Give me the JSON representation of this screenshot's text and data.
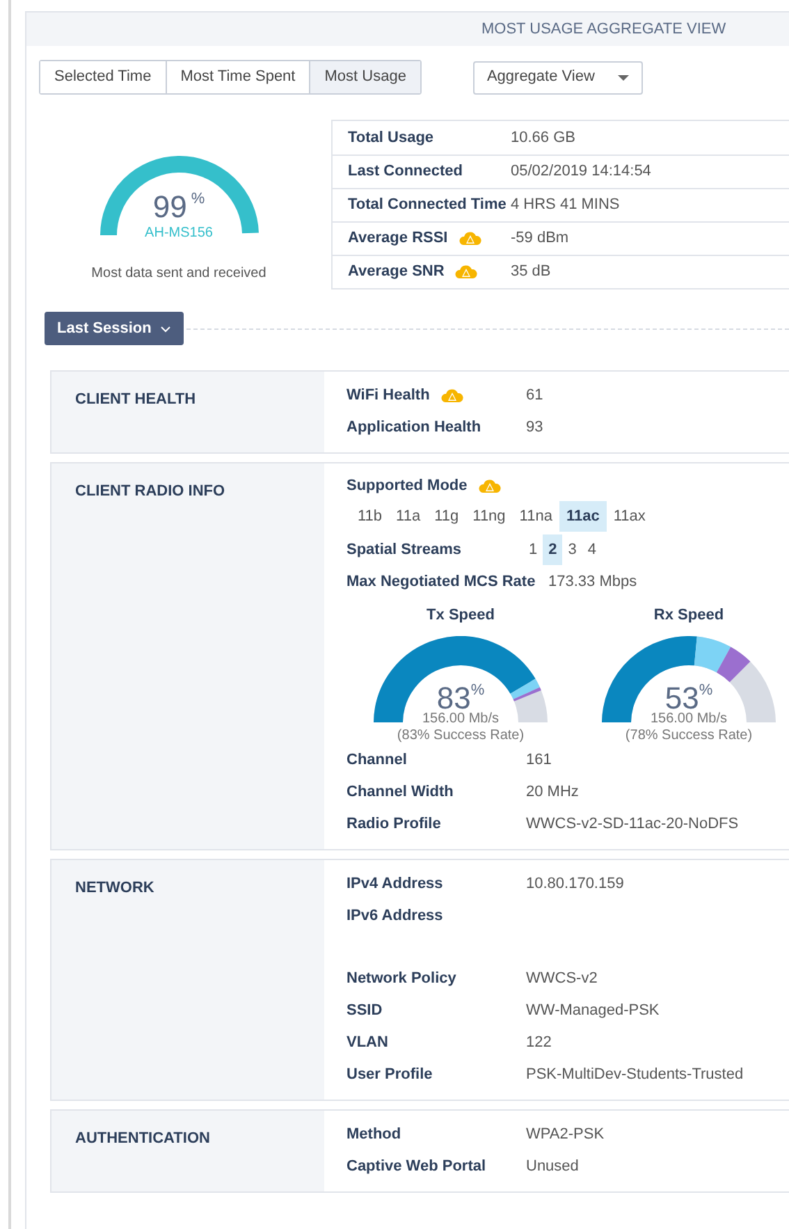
{
  "header": {
    "title": "MOST USAGE AGGREGATE VIEW"
  },
  "time_tabs": [
    {
      "label": "Selected Time",
      "selected": false
    },
    {
      "label": "Most Time Spent",
      "selected": false
    },
    {
      "label": "Most Usage",
      "selected": true
    }
  ],
  "view_dropdown": {
    "value": "Aggregate View"
  },
  "usage_gauge": {
    "value": "99",
    "unit": "%",
    "device": "AH-MS156",
    "caption": "Most data sent and received"
  },
  "summary": [
    {
      "label": "Total Usage",
      "value": "10.66 GB",
      "warning": false
    },
    {
      "label": "Last Connected",
      "value": "05/02/2019 14:14:54",
      "warning": false
    },
    {
      "label": "Total Connected Time",
      "value": "4 HRS 41 MINS",
      "warning": false
    },
    {
      "label": "Average RSSI",
      "value": "-59 dBm",
      "warning": true
    },
    {
      "label": "Average SNR",
      "value": "35 dB",
      "warning": true
    }
  ],
  "session_button": {
    "label": "Last Session"
  },
  "sections": [
    {
      "title": "CLIENT HEALTH",
      "items": [
        {
          "kind": "field",
          "label": "WiFi Health",
          "value": "61",
          "warning": true
        },
        {
          "kind": "field",
          "label": "Application Health",
          "value": "93",
          "warning": false
        }
      ]
    },
    {
      "title": "CLIENT RADIO INFO",
      "items": [
        {
          "kind": "modes",
          "label": "Supported Mode",
          "warning": true,
          "options": [
            {
              "label": "11b",
              "selected": false
            },
            {
              "label": "11a",
              "selected": false
            },
            {
              "label": "11g",
              "selected": false
            },
            {
              "label": "11ng",
              "selected": false
            },
            {
              "label": "11na",
              "selected": false
            },
            {
              "label": "11ac",
              "selected": true
            },
            {
              "label": "11ax",
              "selected": false
            }
          ]
        },
        {
          "kind": "streams",
          "label": "Spatial Streams",
          "options": [
            {
              "label": "1",
              "selected": false
            },
            {
              "label": "2",
              "selected": true
            },
            {
              "label": "3",
              "selected": false
            },
            {
              "label": "4",
              "selected": false
            }
          ]
        },
        {
          "kind": "wide_field",
          "label": "Max Negotiated MCS Rate",
          "value": "173.33 Mbps",
          "warning": false
        },
        {
          "kind": "gauges",
          "gauges": [
            {
              "title": "Tx Speed",
              "value": "83",
              "unit": "%",
              "rate": "156.00 Mb/s",
              "success": "(83% Success Rate)"
            },
            {
              "title": "Rx Speed",
              "value": "53",
              "unit": "%",
              "rate": "156.00 Mb/s",
              "success": "(78% Success Rate)"
            }
          ]
        },
        {
          "kind": "field",
          "label": "Channel",
          "value": "161",
          "warning": false
        },
        {
          "kind": "field",
          "label": "Channel Width",
          "value": "20 MHz",
          "warning": false
        },
        {
          "kind": "field",
          "label": "Radio Profile",
          "value": "WWCS-v2-SD-11ac-20-NoDFS",
          "warning": false
        }
      ]
    },
    {
      "title": "NETWORK",
      "items": [
        {
          "kind": "field",
          "label": "IPv4 Address",
          "value": "10.80.170.159",
          "warning": false
        },
        {
          "kind": "field",
          "label": "IPv6 Address",
          "warning": false
        },
        {
          "kind": "blank"
        },
        {
          "kind": "field",
          "label": "Network Policy",
          "value": "WWCS-v2",
          "warning": false
        },
        {
          "kind": "field",
          "label": "SSID",
          "value": "WW-Managed-PSK",
          "warning": false
        },
        {
          "kind": "field",
          "label": "VLAN",
          "value": "122",
          "warning": false
        },
        {
          "kind": "field",
          "label": "User Profile",
          "value": "PSK-MultiDev-Students-Trusted",
          "warning": false
        }
      ]
    },
    {
      "title": "AUTHENTICATION",
      "items": [
        {
          "kind": "field",
          "label": "Method",
          "value": "WPA2-PSK",
          "warning": false
        },
        {
          "kind": "field",
          "label": "Captive Web Portal",
          "value": "Unused",
          "warning": false
        }
      ]
    }
  ]
}
